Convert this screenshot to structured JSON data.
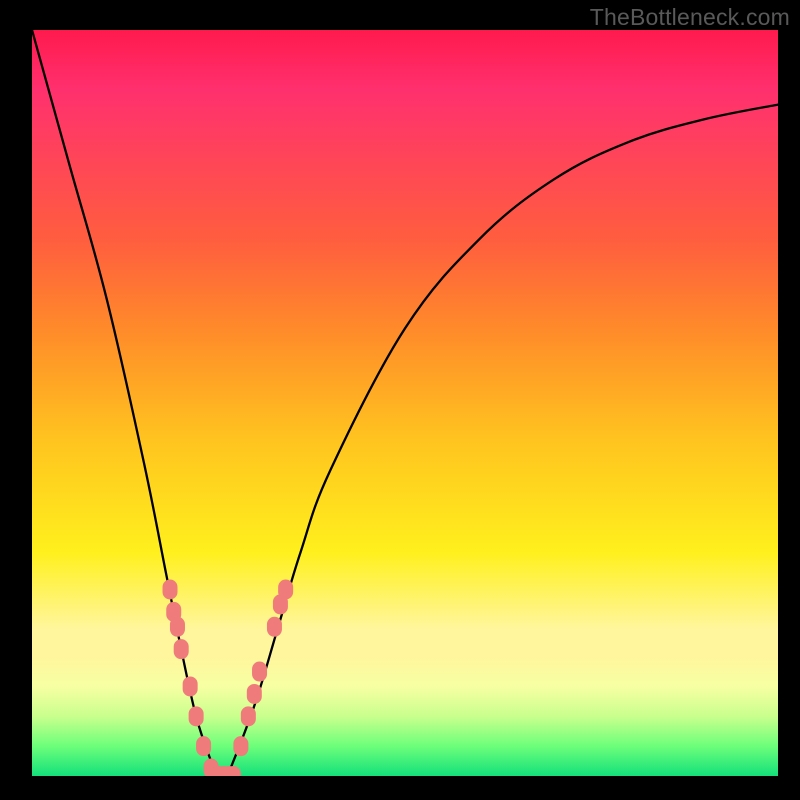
{
  "watermark": "TheBottleneck.com",
  "chart_data": {
    "type": "line",
    "title": "",
    "xlabel": "",
    "ylabel": "",
    "xlim": [
      0,
      100
    ],
    "ylim": [
      0,
      100
    ],
    "grid": false,
    "legend": false,
    "background_gradient": {
      "stops": [
        {
          "pos": 0,
          "color": "#ff1a4d"
        },
        {
          "pos": 28,
          "color": "#ff5d3f"
        },
        {
          "pos": 55,
          "color": "#ffc41f"
        },
        {
          "pos": 80,
          "color": "#fff69d"
        },
        {
          "pos": 100,
          "color": "#13e07a"
        }
      ]
    },
    "series": [
      {
        "name": "bottleneck-curve",
        "color": "#000000",
        "x": [
          0,
          5,
          10,
          15,
          18,
          20,
          22,
          24,
          25,
          26,
          27,
          30,
          33,
          36,
          40,
          50,
          60,
          70,
          80,
          90,
          100
        ],
        "y": [
          100,
          82,
          64,
          42,
          27,
          17,
          8,
          2,
          0,
          0,
          2,
          10,
          20,
          30,
          41,
          60,
          72,
          80,
          85,
          88,
          90
        ]
      }
    ],
    "markers": [
      {
        "name": "left-cluster",
        "color": "#ef7b7b",
        "points": [
          {
            "x": 18.5,
            "y": 25
          },
          {
            "x": 19.0,
            "y": 22
          },
          {
            "x": 19.5,
            "y": 20
          },
          {
            "x": 20.0,
            "y": 17
          },
          {
            "x": 21.2,
            "y": 12
          },
          {
            "x": 22.0,
            "y": 8
          },
          {
            "x": 23.0,
            "y": 4
          },
          {
            "x": 24.0,
            "y": 1
          }
        ]
      },
      {
        "name": "bottom-cluster",
        "color": "#ef7b7b",
        "points": [
          {
            "x": 25.0,
            "y": 0
          },
          {
            "x": 25.7,
            "y": 0
          },
          {
            "x": 26.4,
            "y": 0
          },
          {
            "x": 27.0,
            "y": 0
          }
        ]
      },
      {
        "name": "right-cluster",
        "color": "#ef7b7b",
        "points": [
          {
            "x": 28.0,
            "y": 4
          },
          {
            "x": 29.0,
            "y": 8
          },
          {
            "x": 29.8,
            "y": 11
          },
          {
            "x": 30.5,
            "y": 14
          },
          {
            "x": 32.5,
            "y": 20
          },
          {
            "x": 33.3,
            "y": 23
          },
          {
            "x": 34.0,
            "y": 25
          }
        ]
      }
    ]
  }
}
